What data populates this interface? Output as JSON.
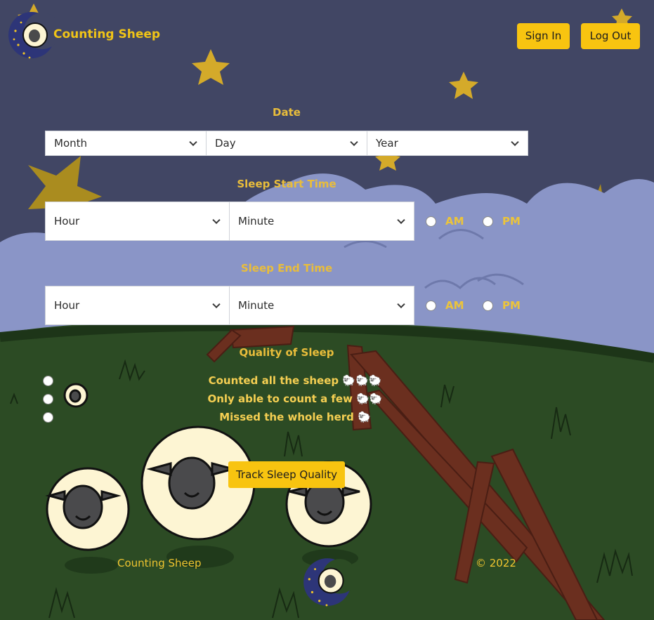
{
  "header": {
    "brand_name": "Counting Sheep",
    "logo_icon": "sheep-moon-logo-icon",
    "sign_in_label": "Sign In",
    "log_out_label": "Log Out"
  },
  "form": {
    "date": {
      "label": "Date",
      "month_value": "Month",
      "day_value": "Day",
      "year_value": "Year"
    },
    "sleep_start": {
      "label": "Sleep Start Time",
      "hour_value": "Hour",
      "minute_value": "Minute",
      "am_label": "AM",
      "pm_label": "PM"
    },
    "sleep_end": {
      "label": "Sleep End Time",
      "hour_value": "Hour",
      "minute_value": "Minute",
      "am_label": "AM",
      "pm_label": "PM"
    },
    "quality": {
      "label": "Quality of Sleep",
      "options": [
        "Counted all the sheep 🐑🐑🐑",
        "Only able to count a few 🐑🐑",
        "Missed the whole herd 🐑"
      ]
    },
    "submit_label": "Track Sleep Quality"
  },
  "footer": {
    "brand_name": "Counting Sheep",
    "copyright": "© 2022",
    "logo_icon": "sheep-moon-logo-icon"
  },
  "colors": {
    "sky": "#414664",
    "cloud": "#8a95c7",
    "hill": "#2c4b24",
    "accent": "#f8c410",
    "label": "#e9bd3b",
    "star": "#d4aa2a",
    "fence": "#6b2f1f"
  }
}
